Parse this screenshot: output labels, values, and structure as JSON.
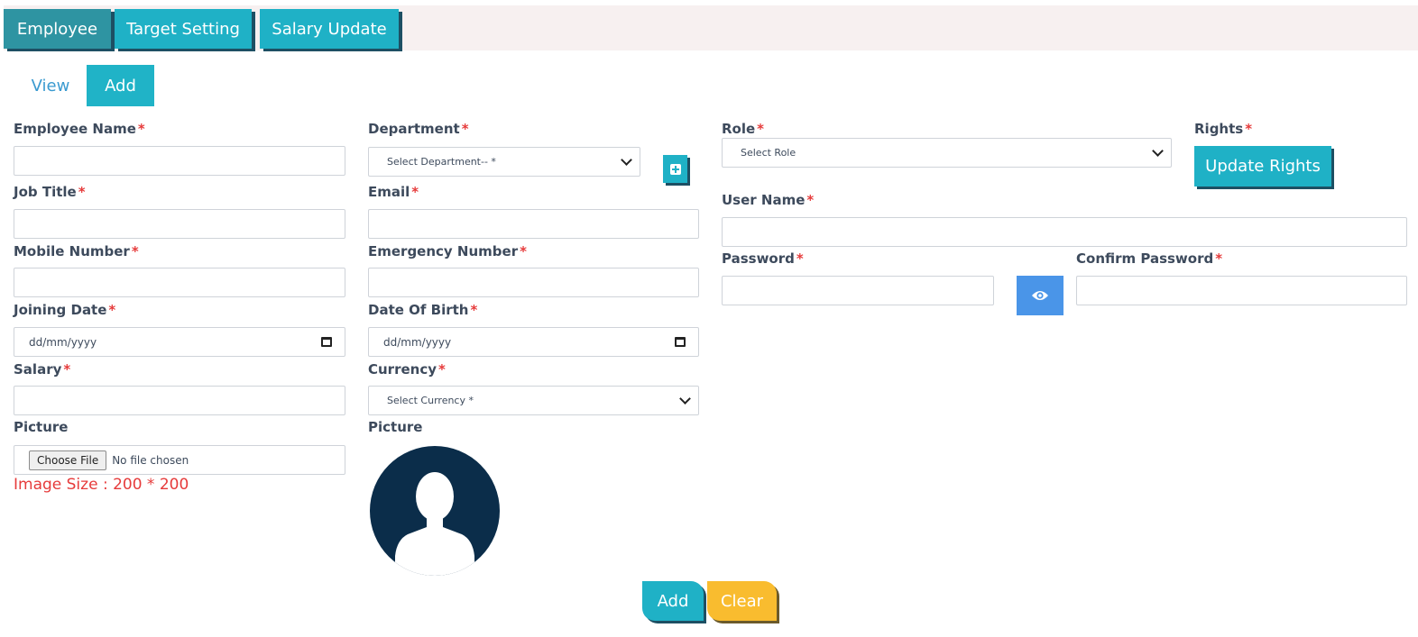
{
  "tabs": [
    {
      "label": "Employee"
    },
    {
      "label": "Target Setting"
    },
    {
      "label": "Salary Update"
    }
  ],
  "subtabs": {
    "view": "View",
    "add": "Add"
  },
  "required_mark": "*",
  "form": {
    "employee_name": {
      "label": "Employee Name",
      "value": ""
    },
    "job_title": {
      "label": "Job Title",
      "value": ""
    },
    "mobile_number": {
      "label": "Mobile Number",
      "value": ""
    },
    "joining_date": {
      "label": "Joining Date",
      "placeholder": "dd/mm/yyyy"
    },
    "salary": {
      "label": "Salary",
      "value": ""
    },
    "picture": {
      "label": "Picture",
      "choose_file": "Choose File",
      "file_status": "No file chosen"
    },
    "image_size_hint": "Image Size : 200 * 200",
    "department": {
      "label": "Department",
      "selected": "Select Department-- *"
    },
    "email": {
      "label": "Email",
      "value": ""
    },
    "emergency_number": {
      "label": "Emergency Number",
      "value": ""
    },
    "date_of_birth": {
      "label": "Date Of Birth",
      "placeholder": "dd/mm/yyyy"
    },
    "currency": {
      "label": "Currency",
      "selected": "Select Currency *"
    },
    "picture_preview": {
      "label": "Picture"
    },
    "role": {
      "label": "Role",
      "selected": "Select Role"
    },
    "rights": {
      "label": "Rights",
      "button": "Update Rights"
    },
    "user_name": {
      "label": "User Name",
      "value": ""
    },
    "password": {
      "label": "Password",
      "value": ""
    },
    "confirm_password": {
      "label": "Confirm Password",
      "value": ""
    }
  },
  "actions": {
    "add": "Add",
    "clear": "Clear"
  },
  "icons": {
    "add_department": "plus-square-icon",
    "toggle_password": "eye-icon",
    "avatar": "user-silhouette-icon"
  },
  "colors": {
    "primary": "#1fb1c6",
    "active_tab": "#2e94a2",
    "warning": "#f9bc2f",
    "required": "#e63b3b",
    "eye_button": "#4a95e8",
    "avatar_bg": "#0b2d4a"
  }
}
